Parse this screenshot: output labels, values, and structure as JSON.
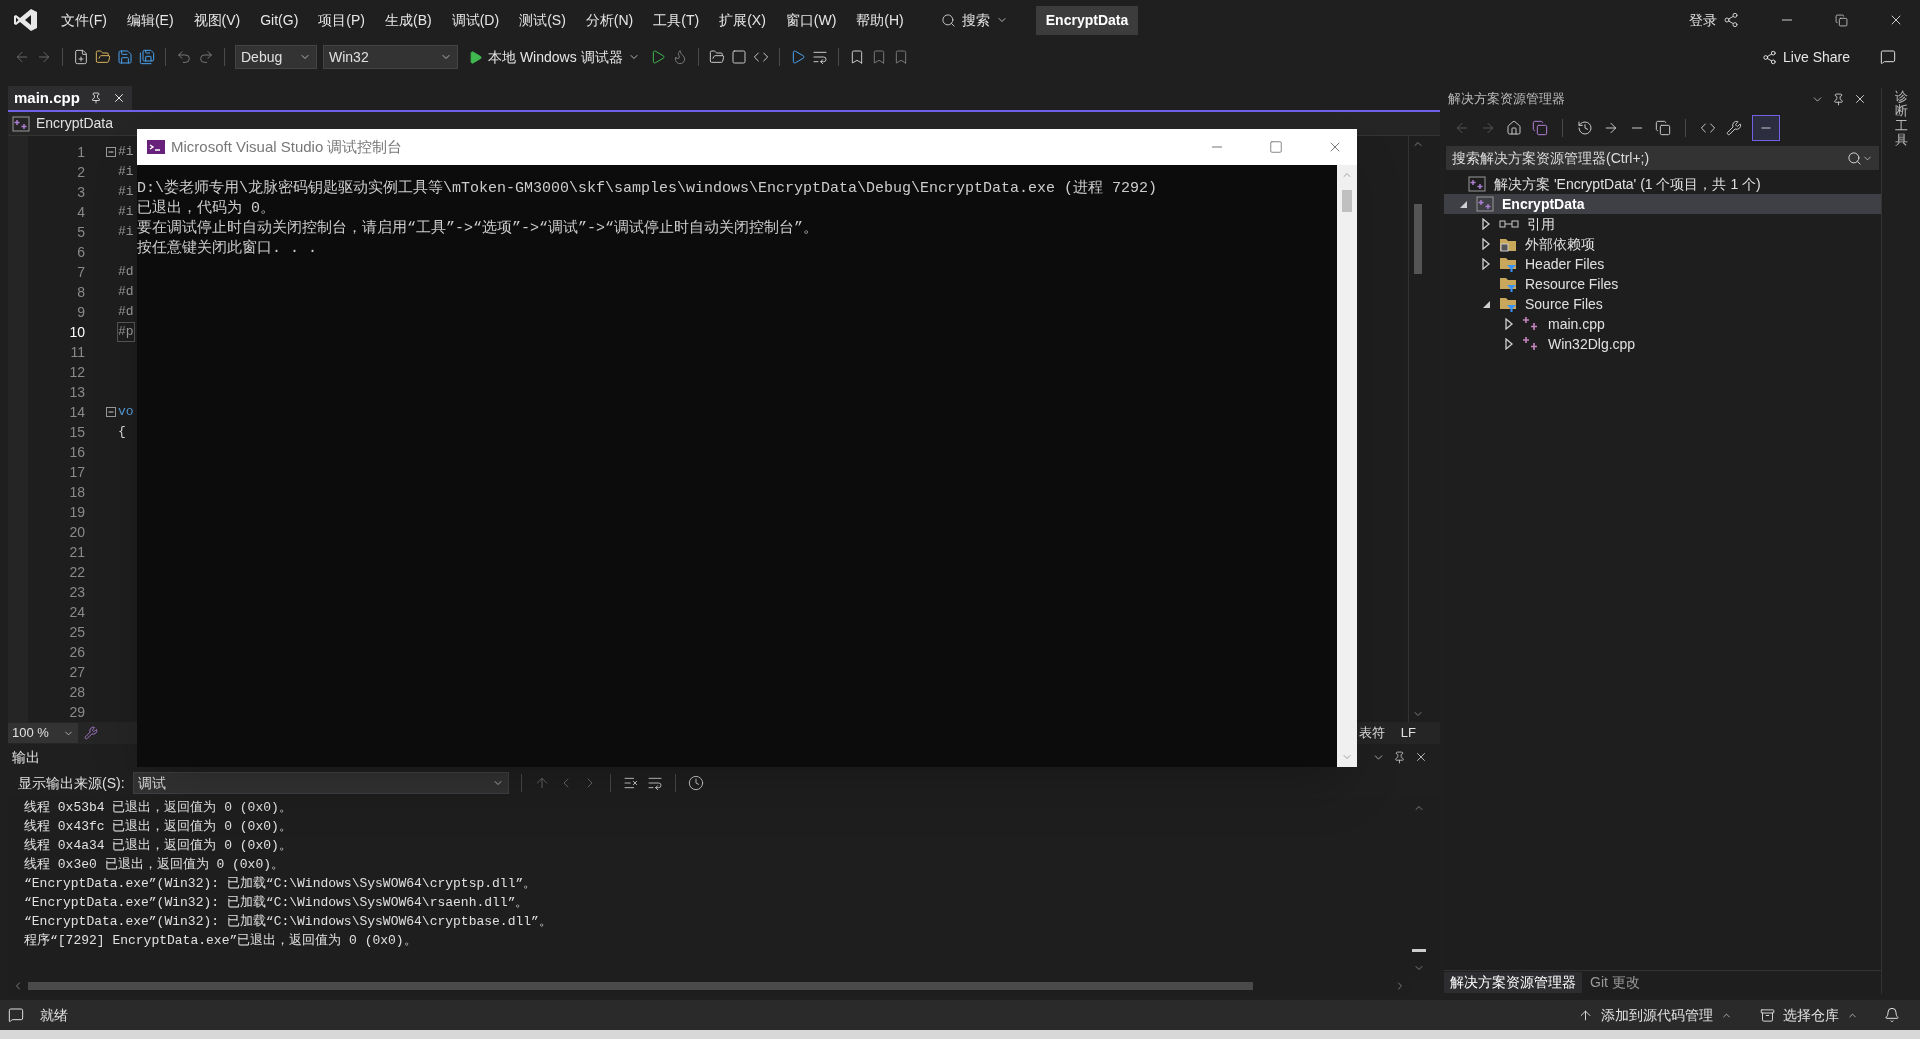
{
  "app": {
    "menu": [
      "文件(F)",
      "编辑(E)",
      "视图(V)",
      "Git(G)",
      "项目(P)",
      "生成(B)",
      "调试(D)",
      "测试(S)",
      "分析(N)",
      "工具(T)",
      "扩展(X)",
      "窗口(W)",
      "帮助(H)"
    ],
    "search": "搜索",
    "title": "EncryptData",
    "sign_in": "登录"
  },
  "toolbar": {
    "configuration": "Debug",
    "platform": "Win32",
    "run": "本地 Windows 调试器",
    "live_share": "Live Share"
  },
  "editor": {
    "tab": {
      "label": "main.cpp",
      "selected": true
    },
    "project": "EncryptData",
    "lines": [
      {
        "number": "1",
        "text": "#i",
        "kind": "directive",
        "fold": true,
        "current": false
      },
      {
        "number": "2",
        "text": "#i",
        "kind": "directive",
        "fold": false,
        "current": false
      },
      {
        "number": "3",
        "text": "#i",
        "kind": "directive",
        "fold": false,
        "current": false
      },
      {
        "number": "4",
        "text": "#i",
        "kind": "directive",
        "fold": false,
        "current": false
      },
      {
        "number": "5",
        "text": "#i",
        "kind": "directive",
        "fold": false,
        "current": false
      },
      {
        "number": "6",
        "fold": false,
        "current": false
      },
      {
        "number": "7",
        "text": "#d",
        "kind": "directive",
        "fold": false,
        "current": false
      },
      {
        "number": "8",
        "text": "#d",
        "kind": "directive",
        "fold": false,
        "current": false
      },
      {
        "number": "9",
        "text": "#d",
        "kind": "directive",
        "fold": false,
        "current": false
      },
      {
        "number": "10",
        "text": "#p",
        "kind": "directive",
        "fold": false,
        "current": true
      },
      {
        "number": "11",
        "fold": false,
        "current": false
      },
      {
        "number": "12",
        "fold": false,
        "current": false
      },
      {
        "number": "13",
        "fold": false,
        "current": false
      },
      {
        "number": "14",
        "text": "vo",
        "kind": "keyword",
        "fold": true,
        "current": false
      },
      {
        "number": "15",
        "text": "{",
        "kind": "plain",
        "fold": false,
        "current": false
      },
      {
        "number": "16",
        "fold": false,
        "current": false
      },
      {
        "number": "17",
        "fold": false,
        "current": false
      },
      {
        "number": "18",
        "fold": false,
        "current": false
      },
      {
        "number": "19",
        "fold": false,
        "current": false
      },
      {
        "number": "20",
        "fold": false,
        "current": false
      },
      {
        "number": "21",
        "fold": false,
        "current": false
      },
      {
        "number": "22",
        "fold": false,
        "current": false
      },
      {
        "number": "23",
        "fold": false,
        "current": false
      },
      {
        "number": "24",
        "fold": false,
        "current": false
      },
      {
        "number": "25",
        "fold": false,
        "current": false
      },
      {
        "number": "26",
        "fold": false,
        "current": false
      },
      {
        "number": "27",
        "fold": false,
        "current": false
      },
      {
        "number": "28",
        "fold": false,
        "current": false
      },
      {
        "number": "29",
        "fold": false,
        "current": false
      }
    ],
    "zoom": "100 %",
    "status": [
      "表符",
      "LF"
    ]
  },
  "console": {
    "title": "Microsoft Visual Studio 调试控制台",
    "lines": [
      "D:\\娄老师专用\\龙脉密码钥匙驱动实例工具等\\mToken-GM3000\\skf\\samples\\windows\\EncryptData\\Debug\\EncryptData.exe (进程 7292)",
      "已退出，代码为 0。",
      "要在调试停止时自动关闭控制台，请启用“工具”->“选项”->“调试”->“调试停止时自动关闭控制台”。",
      "按任意键关闭此窗口. . ."
    ]
  },
  "output": {
    "title": "输出",
    "source_label": "显示输出来源(S):",
    "source": "调试",
    "lines": [
      "线程 0x53b4 已退出，返回值为 0 (0x0)。",
      "线程 0x43fc 已退出，返回值为 0 (0x0)。",
      "线程 0x4a34 已退出，返回值为 0 (0x0)。",
      "线程 0x3e0 已退出，返回值为 0 (0x0)。",
      "“EncryptData.exe”(Win32): 已加载“C:\\Windows\\SysWOW64\\cryptsp.dll”。",
      "“EncryptData.exe”(Win32): 已加载“C:\\Windows\\SysWOW64\\rsaenh.dll”。",
      "“EncryptData.exe”(Win32): 已加载“C:\\Windows\\SysWOW64\\cryptbase.dll”。",
      "程序“[7292] EncryptData.exe”已退出，返回值为 0 (0x0)。"
    ]
  },
  "solution_explorer": {
    "title": "解决方案资源管理器",
    "search_placeholder": "搜索解决方案资源管理器(Ctrl+;)",
    "solution": "解决方案 'EncryptData' (1 个项目，共 1 个)",
    "tree": [
      {
        "label": "EncryptData",
        "kind": "project",
        "expandable": true,
        "expanded": true,
        "selected": true,
        "children": [
          {
            "label": "引用",
            "kind": "references",
            "expandable": true,
            "expanded": false,
            "selected": false
          },
          {
            "label": "外部依赖项",
            "kind": "external",
            "expandable": true,
            "expanded": false,
            "selected": false
          },
          {
            "label": "Header Files",
            "kind": "filter",
            "expandable": true,
            "expanded": false,
            "selected": false
          },
          {
            "label": "Resource Files",
            "kind": "filter",
            "expandable": false,
            "selected": false
          },
          {
            "label": "Source Files",
            "kind": "filter",
            "expandable": true,
            "expanded": true,
            "selected": false,
            "children": [
              {
                "label": "main.cpp",
                "kind": "cpp",
                "expandable": true,
                "expanded": false,
                "selected": false
              },
              {
                "label": "Win32Dlg.cpp",
                "kind": "cpp",
                "expandable": true,
                "expanded": false,
                "selected": false
              }
            ]
          }
        ]
      }
    ],
    "tabs": [
      {
        "label": "解决方案资源管理器",
        "selected": true
      },
      {
        "label": "Git 更改",
        "selected": false
      }
    ]
  },
  "side_strip": "诊断工具",
  "status_bar": {
    "state": "就绪",
    "source_control": "添加到源代码管理",
    "repository": "选择仓库"
  }
}
